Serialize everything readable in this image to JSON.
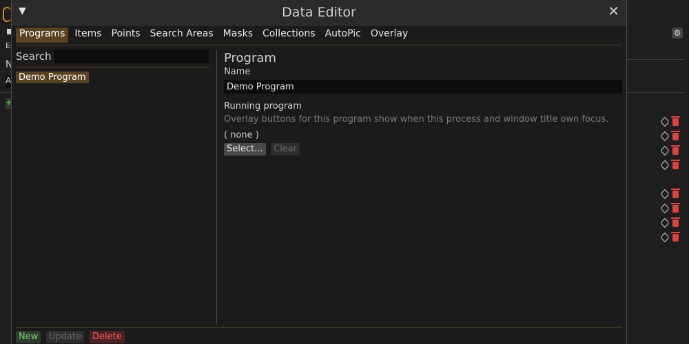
{
  "background": {
    "left_texts": [
      "Es",
      "N",
      "A",
      "+"
    ],
    "gear_icon": "gear-icon",
    "row_icons": [
      "tag-icon",
      "trash-icon"
    ]
  },
  "dialog": {
    "title": "Data Editor",
    "collapse_glyph": "▼",
    "close_glyph": "✕",
    "tabs": [
      {
        "label": "Programs",
        "active": true
      },
      {
        "label": "Items"
      },
      {
        "label": "Points"
      },
      {
        "label": "Search Areas"
      },
      {
        "label": "Masks"
      },
      {
        "label": "Collections"
      },
      {
        "label": "AutoPic"
      },
      {
        "label": "Overlay"
      }
    ]
  },
  "left_pane": {
    "search_label": "Search",
    "search_value": "",
    "items": [
      "Demo Program"
    ]
  },
  "right_pane": {
    "section_title": "Program",
    "name_label": "Name",
    "name_value": "Demo Program",
    "running_label": "Running program",
    "running_hint": "Overlay buttons for this program show when this process and window title own focus.",
    "running_value": "( none )",
    "select_label": "Select...",
    "clear_label": "Clear"
  },
  "footer": {
    "new_label": "New",
    "update_label": "Update",
    "delete_label": "Delete"
  },
  "colors": {
    "accent": "#5a4320",
    "border": "#5a4a2a",
    "new": "#6fd86f",
    "delete": "#ff5a5a"
  }
}
